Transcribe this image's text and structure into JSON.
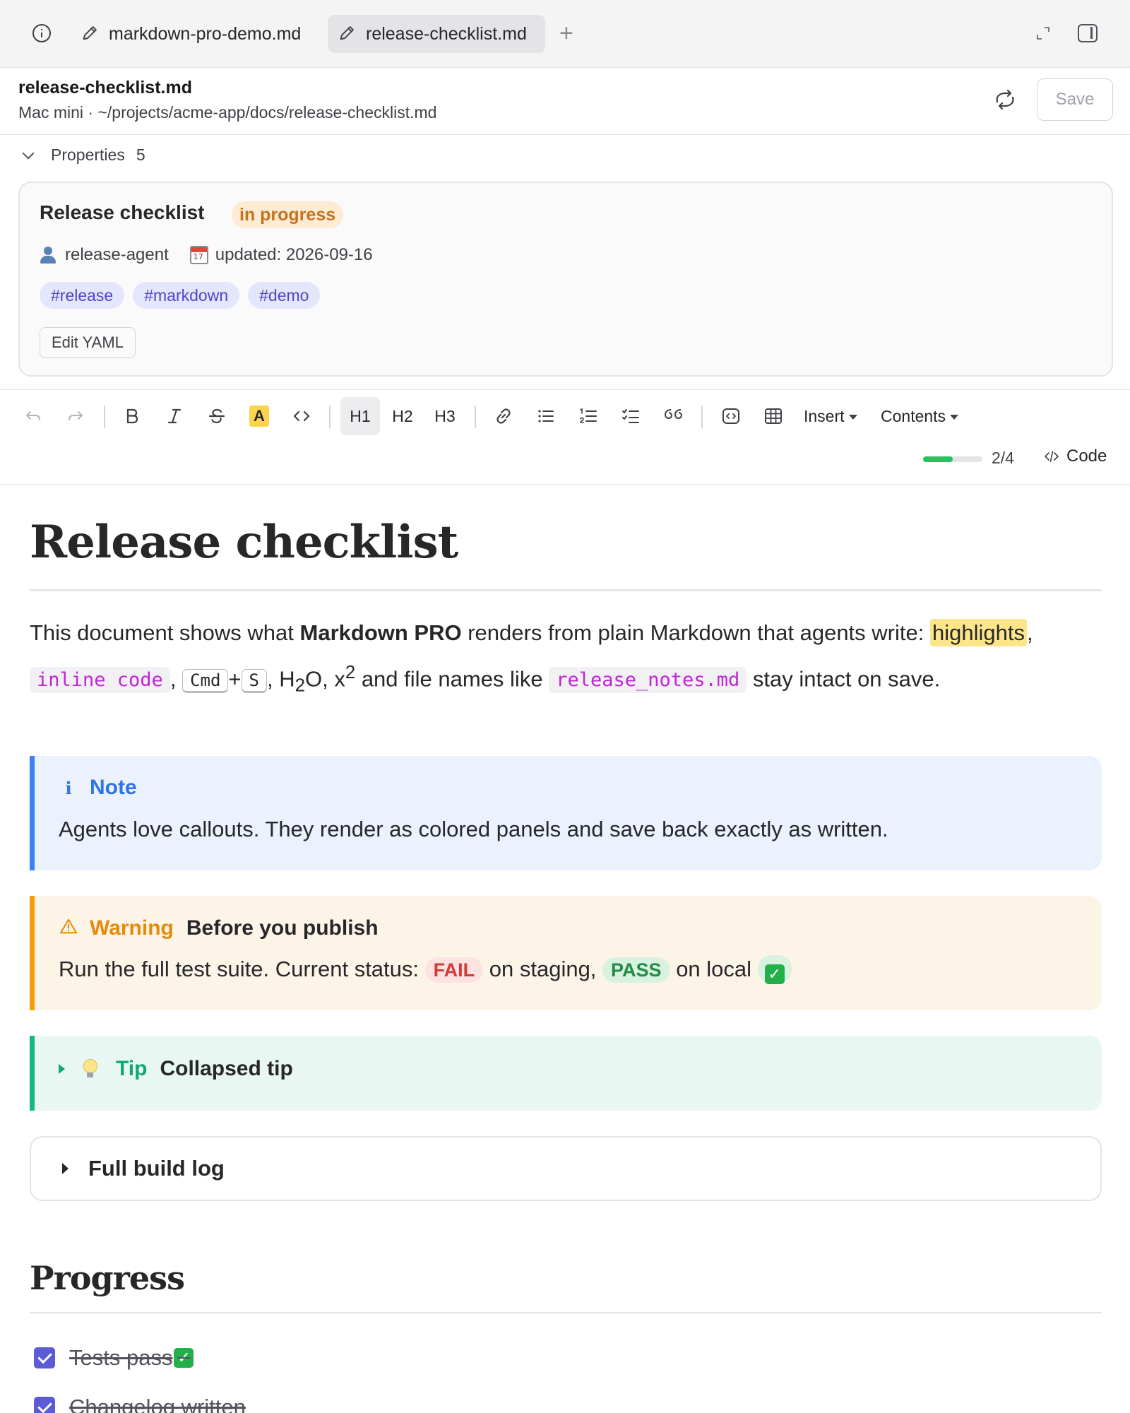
{
  "tabs": [
    {
      "label": "markdown-pro-demo.md",
      "active": false
    },
    {
      "label": "release-checklist.md",
      "active": true
    }
  ],
  "file": {
    "name": "release-checklist.md",
    "path": "Mac mini · ~/projects/acme-app/docs/release-checklist.md",
    "save_label": "Save"
  },
  "properties": {
    "label": "Properties",
    "count": "5",
    "title": "Release checklist",
    "status": "in progress",
    "author": "release-agent",
    "updated": "updated: 2026-09-16",
    "tags": [
      "#release",
      "#markdown",
      "#demo"
    ],
    "edit_yaml_label": "Edit YAML"
  },
  "toolbar": {
    "highlight_letter": "A",
    "h1": "H1",
    "h2": "H2",
    "h3": "H3",
    "insert": "Insert",
    "contents": "Contents",
    "progress_text": "2/4",
    "progress_fraction": 0.5,
    "code_label": "Code",
    "icons": [
      "undo-icon",
      "redo-icon",
      "bold-icon",
      "italic-icon",
      "strikethrough-icon",
      "highlight-icon",
      "inline-code-icon",
      "link-icon",
      "bullet-list-icon",
      "numbered-list-icon",
      "task-list-icon",
      "quote-icon",
      "code-block-icon",
      "table-icon"
    ]
  },
  "doc": {
    "h1": "Release checklist",
    "intro": {
      "t1": "This document shows what ",
      "bold": "Markdown PRO",
      "t2": " renders from plain Markdown that agents write: ",
      "highlight": "highlights",
      "c1": ",",
      "inline_code": "inline code",
      "c2": ",",
      "kbd1": "Cmd",
      "plus": "+",
      "kbd2": "S",
      "t3": ", H",
      "sub": "2",
      "t4": "O, x",
      "sup": "2",
      "t5": " and file names like ",
      "filename": "release_notes.md",
      "t6": " stay intact on save."
    },
    "note": {
      "label": "Note",
      "body": "Agents love callouts. They render as colored panels and save back exactly as written."
    },
    "warning": {
      "label": "Warning",
      "title": "Before you publish",
      "body_start": "Run the full test suite. Current status: ",
      "fail": "FAIL",
      "mid": " on staging, ",
      "pass": "PASS",
      "end": " on local "
    },
    "tip": {
      "label": "Tip",
      "title": "Collapsed tip"
    },
    "details_summary": "Full build log",
    "h2": "Progress",
    "tasks": [
      {
        "label": "Tests pass ",
        "done": true,
        "emoji": "check-mark-emoji"
      },
      {
        "label": "Changelog written",
        "done": true
      }
    ]
  },
  "colors": {
    "accent": "#5b5bd6",
    "note": "#3b82f6",
    "warning": "#f59e0b",
    "tip": "#14b87c",
    "progress": "#22c55e"
  }
}
